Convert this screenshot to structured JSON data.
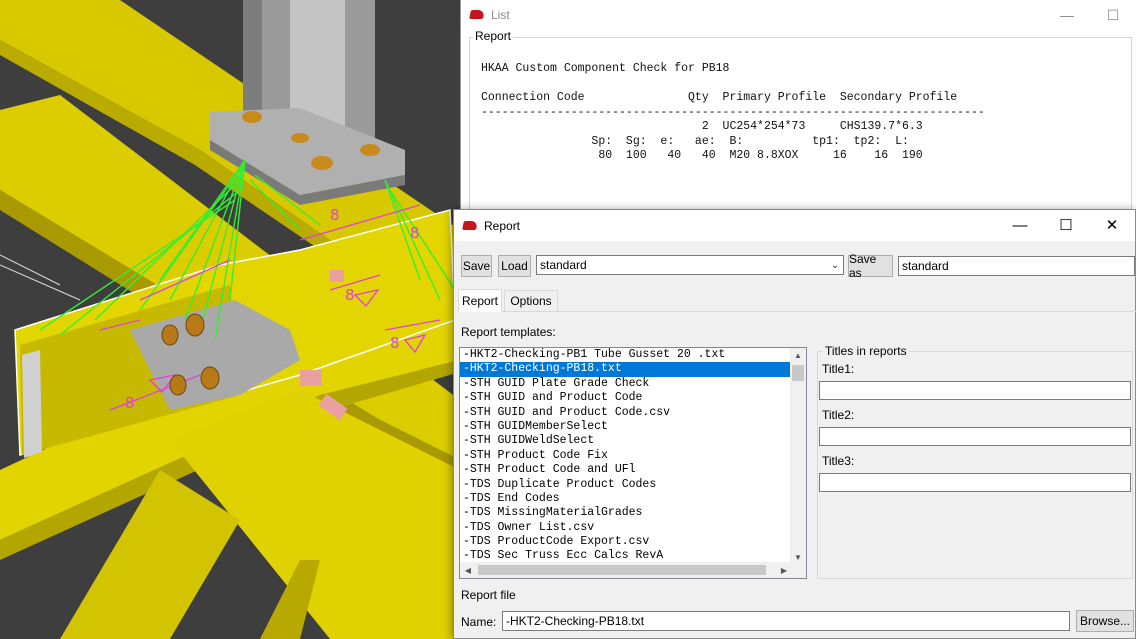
{
  "list_window": {
    "title": "List",
    "group_label": "Report",
    "report_lines": [
      "HKAA Custom Component Check for PB18",
      "",
      "Connection Code               Qty  Primary Profile  Secondary Profile",
      "-------------------------------------------------------------------------",
      "                                2  UC254*254*73     CHS139.7*6.3",
      "                Sp:  Sg:  e:   ae:  B:          tp1:  tp2:  L:",
      "                 80  100   40   40  M20 8.8XOX     16    16  190"
    ],
    "controls": {
      "minimize": "—",
      "maximize": "☐"
    }
  },
  "report_window": {
    "title": "Report",
    "controls": {
      "minimize": "—",
      "maximize": "☐",
      "close": "✕"
    },
    "toolbar": {
      "save_label": "Save",
      "load_label": "Load",
      "settings_value": "standard",
      "save_as_label": "Save as",
      "save_as_value": "standard"
    },
    "tabs": [
      {
        "label": "Report"
      },
      {
        "label": "Options"
      }
    ],
    "templates_label": "Report templates:",
    "templates": [
      "-HKT2-Checking-PB1 Tube Gusset 20 .txt",
      "-HKT2-Checking-PB18.txt",
      "-STH GUID Plate Grade Check",
      "-STH GUID and Product Code",
      "-STH GUID and Product Code.csv",
      "-STH GUIDMemberSelect",
      "-STH GUIDWeldSelect",
      "-STH Product Code Fix",
      "-STH Product Code and UFl",
      "-TDS Duplicate Product Codes",
      "-TDS End Codes",
      "-TDS MissingMaterialGrades",
      "-TDS Owner List.csv",
      "-TDS ProductCode Export.csv",
      "-TDS Sec Truss Ecc Calcs RevA"
    ],
    "selected_template_index": 1,
    "titles_group_label": "Titles in reports",
    "title1_label": "Title1:",
    "title2_label": "Title2:",
    "title3_label": "Title3:",
    "title1_value": "",
    "title2_value": "",
    "title3_value": "",
    "report_file_label": "Report file",
    "name_label": "Name:",
    "name_value": "-HKT2-Checking-PB18.txt",
    "browse_label": "Browse..."
  },
  "colors": {
    "selection": "#0078d7",
    "steel_yellow": "#e2d200",
    "weld_magenta": "#e040e0",
    "bolt_lines_green": "#33ee33",
    "tekla_red": "#c4161c"
  },
  "viewport_icons": [
    "bolt-icon",
    "weld-symbol-icon"
  ]
}
